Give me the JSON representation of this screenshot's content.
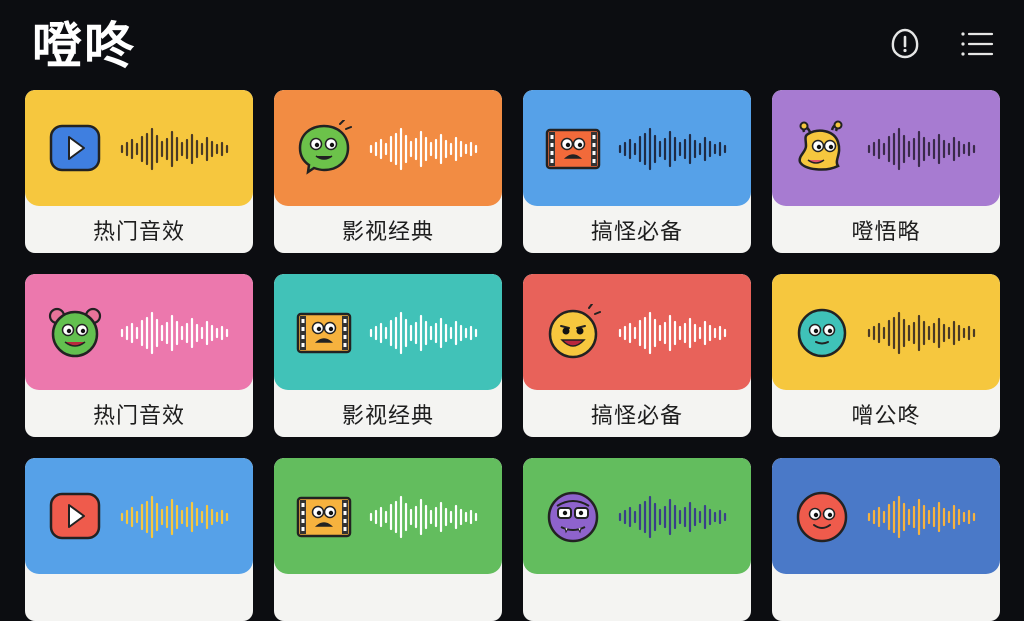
{
  "app": {
    "title": "噔咚",
    "header_icons": [
      "notification-bell-icon",
      "menu-list-icon"
    ]
  },
  "cards": [
    {
      "label": "热门音效",
      "color": "#f6c73e",
      "icon": "play-button-icon",
      "icon_color": "#3f7fe0",
      "wave_color": "#4a3a25"
    },
    {
      "label": "影视经典",
      "color": "#f28c43",
      "icon": "green-face-icon",
      "icon_color": "#6cc24a",
      "wave_color": "#ffffff"
    },
    {
      "label": "搞怪必备",
      "color": "#56a1e8",
      "icon": "film-face-icon",
      "icon_color": "#f26a3a",
      "wave_color": "#1f2b45"
    },
    {
      "label": "噔悟略",
      "color": "#a77bd1",
      "icon": "yellow-creature-icon",
      "icon_color": "#f6c73e",
      "wave_color": "#3a2a4a"
    },
    {
      "label": "热门音效",
      "color": "#ec78ad",
      "icon": "green-bear-face-icon",
      "icon_color": "#63c04f",
      "wave_color": "#ffffff"
    },
    {
      "label": "影视经典",
      "color": "#41c2b8",
      "icon": "film-face-icon",
      "icon_color": "#f6b23e",
      "wave_color": "#ffffff"
    },
    {
      "label": "搞怪必备",
      "color": "#e8625a",
      "icon": "yellow-face-icon",
      "icon_color": "#f6c73e",
      "wave_color": "#ffffff"
    },
    {
      "label": "噌公咚",
      "color": "#f6c73e",
      "icon": "teal-face-icon",
      "icon_color": "#3fc2b8",
      "wave_color": "#4a3a25"
    },
    {
      "label": "",
      "color": "#56a1e8",
      "icon": "play-button-icon",
      "icon_color": "#ef5b4c",
      "wave_color": "#f6c73e"
    },
    {
      "label": "",
      "color": "#63bd5e",
      "icon": "film-face-icon",
      "icon_color": "#f6b23e",
      "wave_color": "#ffffff"
    },
    {
      "label": "",
      "color": "#63bd5e",
      "icon": "purple-monster-icon",
      "icon_color": "#8e63cc",
      "wave_color": "#3a3f8a"
    },
    {
      "label": "",
      "color": "#4a79c8",
      "icon": "red-face-icon",
      "icon_color": "#ef5b4c",
      "wave_color": "#f6b23e"
    }
  ]
}
